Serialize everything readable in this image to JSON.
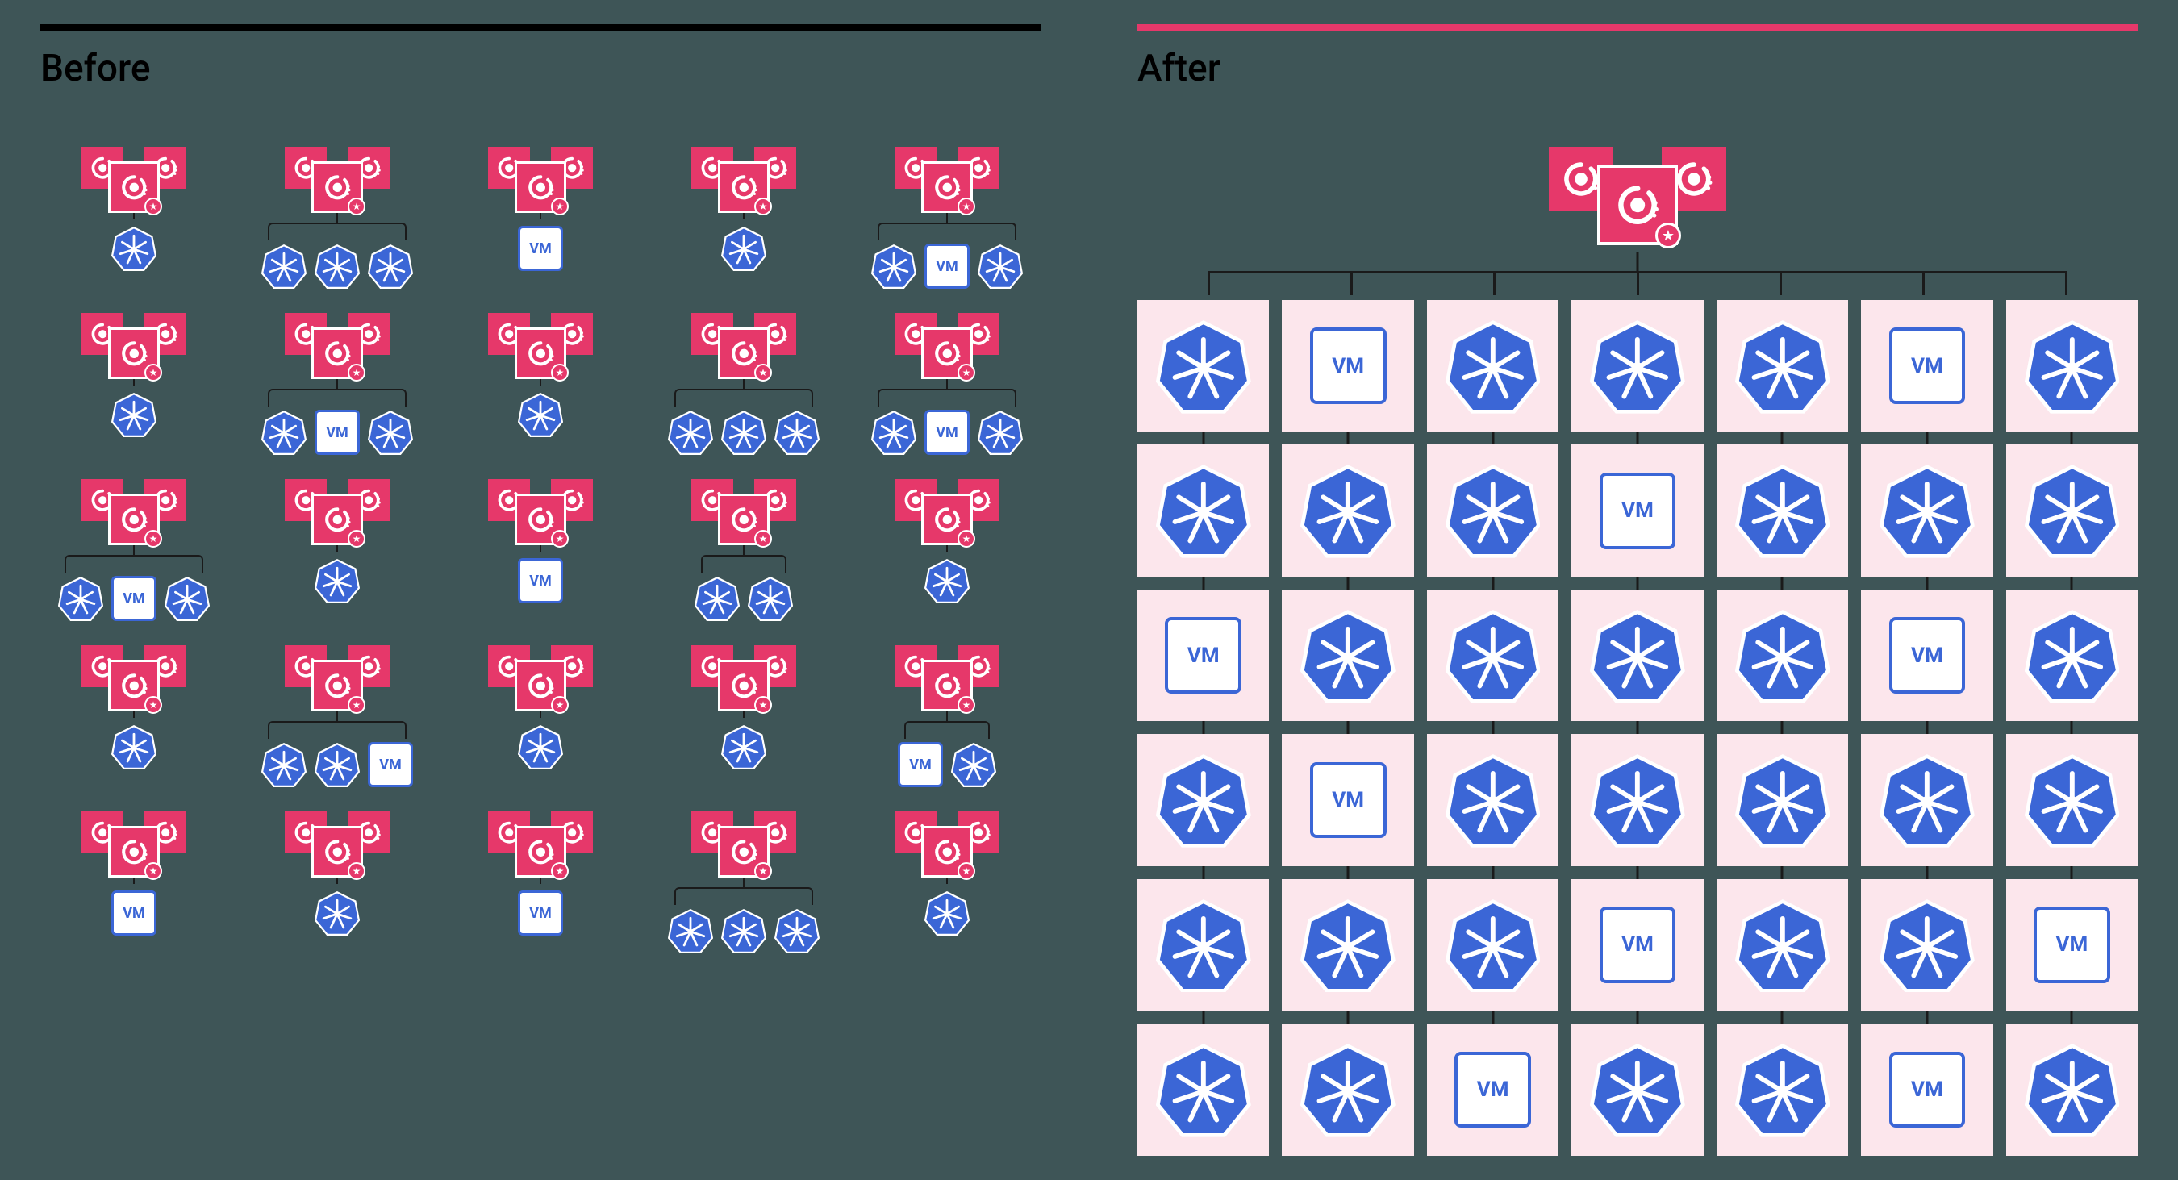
{
  "labels": {
    "before": "Before",
    "after": "After",
    "vm": "VM"
  },
  "colors": {
    "background": "#3e5557",
    "accent_pink": "#e6386a",
    "tile_bg": "#fce6ec",
    "k8s_blue": "#3b66d6",
    "rule_black": "#000000"
  },
  "icons": {
    "consul": "consul-icon",
    "kubernetes": "kubernetes-icon",
    "vm": "vm-icon",
    "star": "star-icon"
  },
  "diagram": {
    "description": "Comparison of many independent Consul server clusters (Before) versus a single consolidated Consul control plane managing all workloads (After).",
    "before": {
      "cluster_count": 25,
      "layout": "5 columns x 5 rows of independent Consul server trios, each with 1–3 child workloads",
      "clusters": [
        {
          "row": 1,
          "col": 1,
          "children": [
            "k8s"
          ]
        },
        {
          "row": 1,
          "col": 2,
          "children": [
            "k8s",
            "k8s",
            "k8s"
          ]
        },
        {
          "row": 1,
          "col": 3,
          "children": [
            "vm"
          ]
        },
        {
          "row": 1,
          "col": 4,
          "children": [
            "k8s"
          ]
        },
        {
          "row": 1,
          "col": 5,
          "children": [
            "k8s",
            "vm",
            "k8s"
          ]
        },
        {
          "row": 2,
          "col": 1,
          "children": [
            "k8s"
          ]
        },
        {
          "row": 2,
          "col": 2,
          "children": [
            "k8s",
            "vm",
            "k8s"
          ]
        },
        {
          "row": 2,
          "col": 3,
          "children": [
            "k8s"
          ]
        },
        {
          "row": 2,
          "col": 4,
          "children": [
            "k8s",
            "k8s",
            "k8s"
          ]
        },
        {
          "row": 2,
          "col": 5,
          "children": [
            "k8s",
            "vm",
            "k8s"
          ]
        },
        {
          "row": 3,
          "col": 1,
          "children": [
            "k8s",
            "vm",
            "k8s"
          ]
        },
        {
          "row": 3,
          "col": 2,
          "children": [
            "k8s"
          ]
        },
        {
          "row": 3,
          "col": 3,
          "children": [
            "vm"
          ]
        },
        {
          "row": 3,
          "col": 4,
          "children": [
            "k8s",
            "k8s"
          ]
        },
        {
          "row": 3,
          "col": 5,
          "children": [
            "k8s"
          ]
        },
        {
          "row": 4,
          "col": 1,
          "children": [
            "k8s"
          ]
        },
        {
          "row": 4,
          "col": 2,
          "children": [
            "k8s",
            "k8s",
            "vm"
          ]
        },
        {
          "row": 4,
          "col": 3,
          "children": [
            "k8s"
          ]
        },
        {
          "row": 4,
          "col": 4,
          "children": [
            "k8s"
          ]
        },
        {
          "row": 4,
          "col": 5,
          "children": [
            "vm",
            "k8s"
          ]
        },
        {
          "row": 5,
          "col": 1,
          "children": [
            "vm"
          ]
        },
        {
          "row": 5,
          "col": 2,
          "children": [
            "k8s"
          ]
        },
        {
          "row": 5,
          "col": 3,
          "children": [
            "vm"
          ]
        },
        {
          "row": 5,
          "col": 4,
          "children": [
            "k8s",
            "k8s",
            "k8s"
          ]
        },
        {
          "row": 5,
          "col": 5,
          "children": [
            "k8s"
          ]
        }
      ]
    },
    "after": {
      "control_plane": "single Consul server trio",
      "grid": {
        "rows": 6,
        "cols": 7
      },
      "tiles": [
        [
          "k8s",
          "vm",
          "k8s",
          "k8s",
          "k8s",
          "vm",
          "k8s"
        ],
        [
          "k8s",
          "k8s",
          "k8s",
          "vm",
          "k8s",
          "k8s",
          "k8s"
        ],
        [
          "vm",
          "k8s",
          "k8s",
          "k8s",
          "k8s",
          "vm",
          "k8s"
        ],
        [
          "k8s",
          "vm",
          "k8s",
          "k8s",
          "k8s",
          "k8s",
          "k8s"
        ],
        [
          "k8s",
          "k8s",
          "k8s",
          "vm",
          "k8s",
          "k8s",
          "vm"
        ],
        [
          "k8s",
          "k8s",
          "vm",
          "k8s",
          "k8s",
          "vm",
          "k8s"
        ]
      ]
    }
  }
}
